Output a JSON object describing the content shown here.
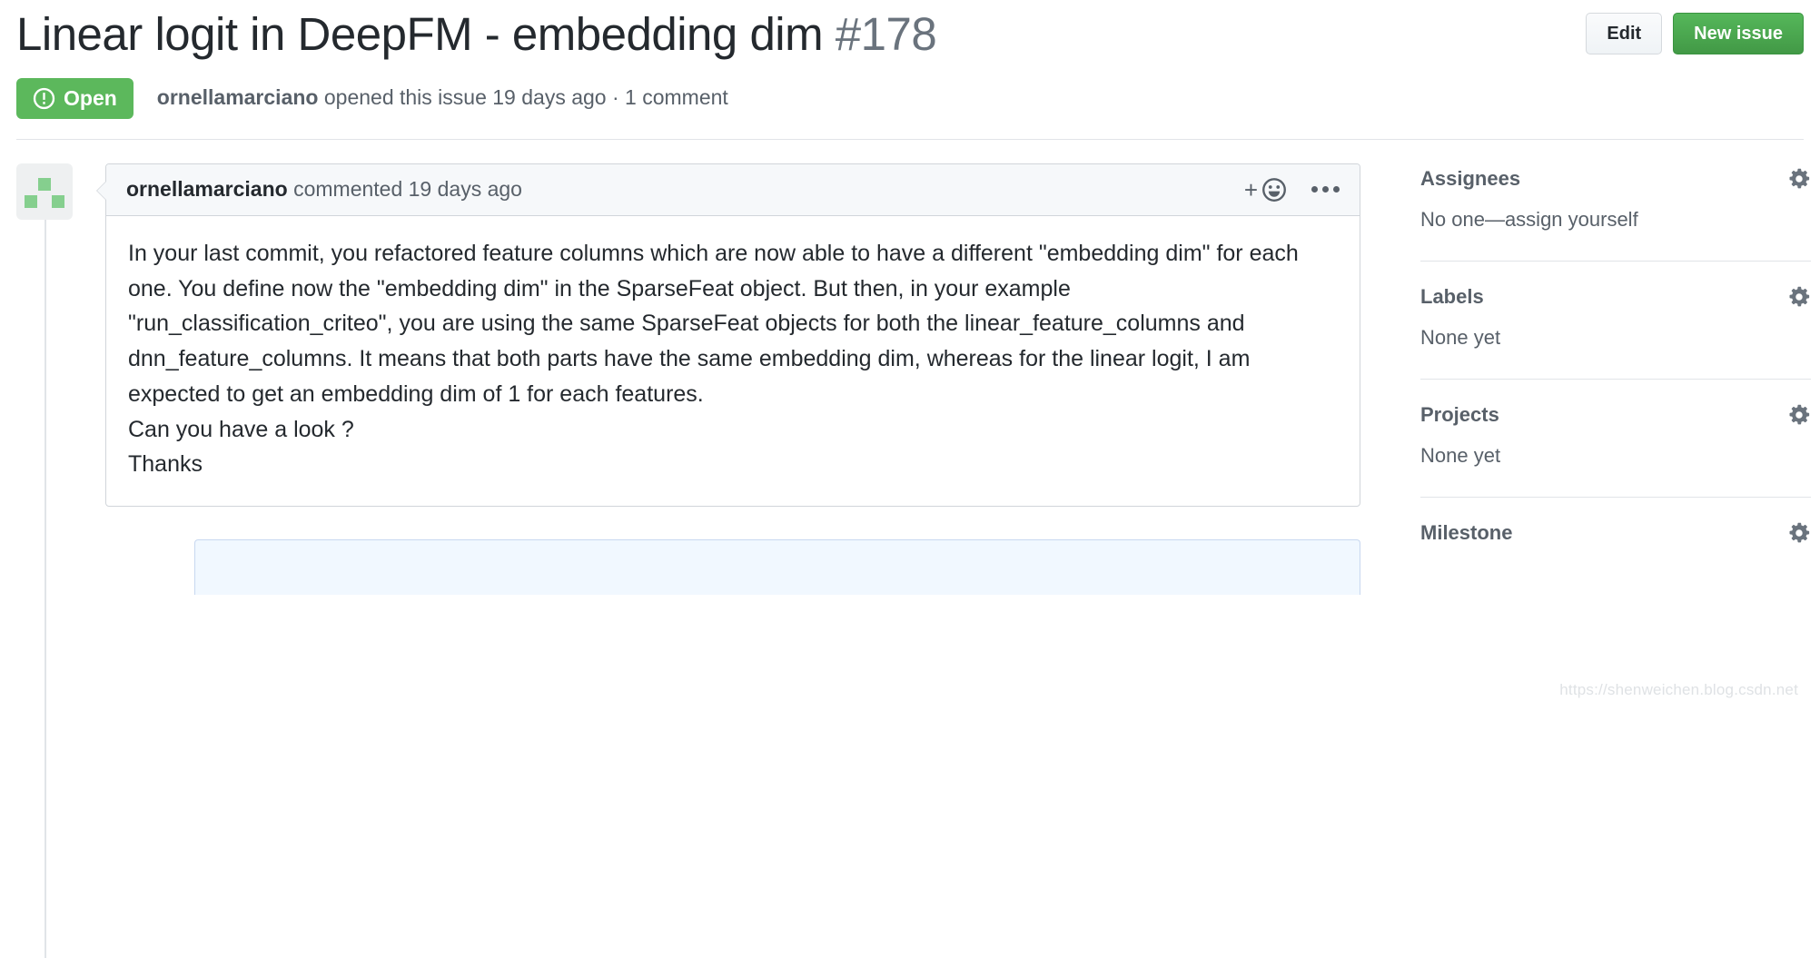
{
  "header": {
    "title": "Linear logit in DeepFM - embedding dim",
    "issue_number": "#178",
    "edit_button": "Edit",
    "new_issue_button": "New issue",
    "state_badge": {
      "label": "Open",
      "icon": "issue-opened-icon",
      "color": "#5cb85c"
    },
    "meta_author": "ornellamarciano",
    "meta_rest": " opened this issue 19 days ago · 1 comment"
  },
  "comment": {
    "avatar_icon": "identicon-avatar",
    "author": "ornellamarciano",
    "action_time": " commented 19 days ago",
    "reaction_icon": "add-reaction-smiley-icon",
    "menu_icon": "kebab-horizontal-icon",
    "body_paragraph": "In your last commit, you refactored feature columns which are now able to have a different \"embedding dim\" for each one. You define now the \"embedding dim\" in the SparseFeat object. But then, in your example \"run_classification_criteo\", you are using the same SparseFeat objects for both the linear_feature_columns and dnn_feature_columns. It means that both parts have the same embedding dim, whereas for the linear logit, I am expected to get an embedding dim of 1 for each features.",
    "body_line_2": "Can you have a look ?",
    "body_line_3": "Thanks"
  },
  "sidebar": {
    "sections": [
      {
        "title": "Assignees",
        "value": "No one—assign yourself",
        "gear_icon": "gear-icon"
      },
      {
        "title": "Labels",
        "value": "None yet",
        "gear_icon": "gear-icon"
      },
      {
        "title": "Projects",
        "value": "None yet",
        "gear_icon": "gear-icon"
      },
      {
        "title": "Milestone",
        "value": "",
        "gear_icon": "gear-icon"
      }
    ]
  },
  "watermark": "https://shenweichen.blog.csdn.net"
}
